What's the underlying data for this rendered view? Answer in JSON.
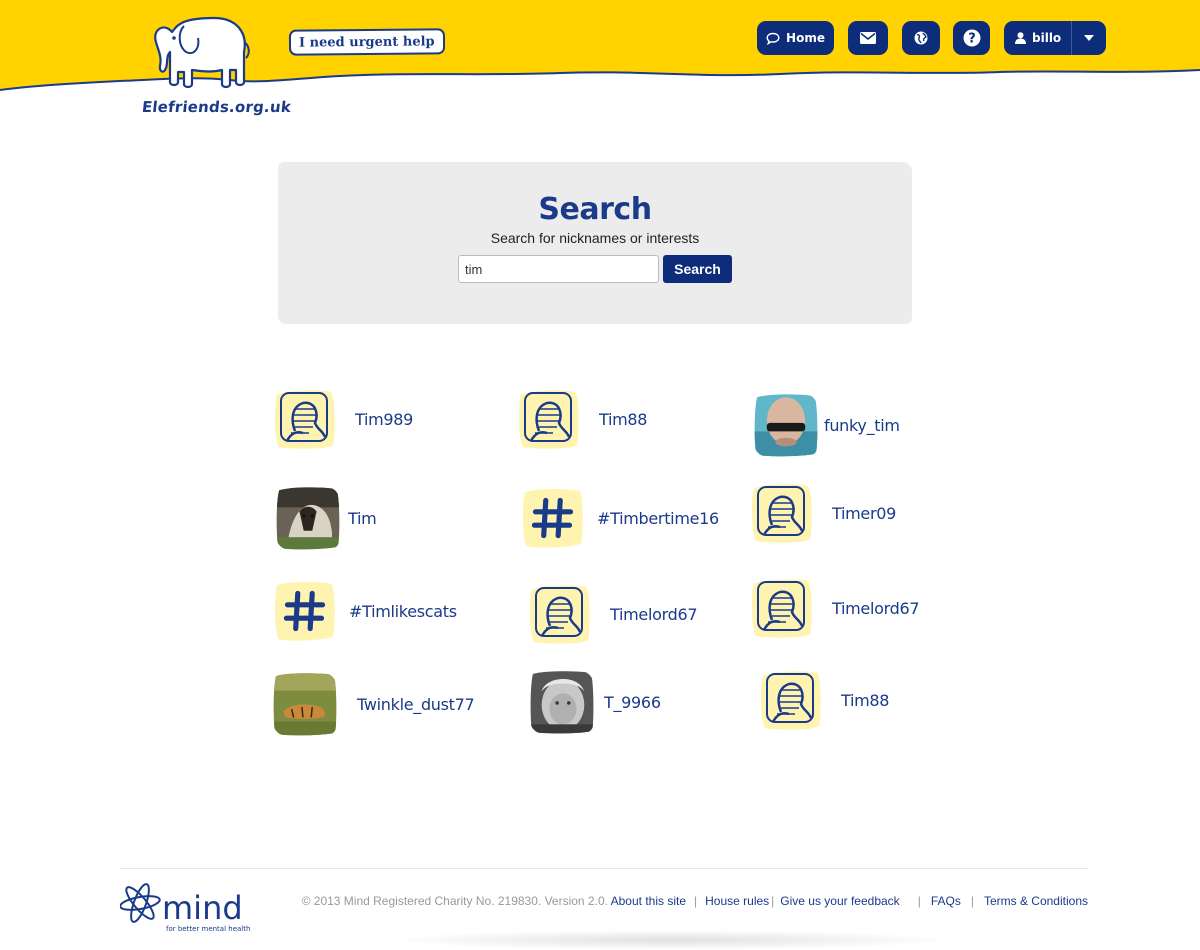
{
  "header": {
    "site_name": "Elefriends.org.uk",
    "urgent_help_label": "I need urgent help",
    "nav": {
      "home_label": "Home",
      "user_label": "billo"
    },
    "icons": {
      "home": "speech-bubble-icon",
      "mail": "envelope-icon",
      "globe": "globe-icon",
      "help": "question-icon",
      "user": "user-icon",
      "menu": "caret-down-icon"
    },
    "colors": {
      "band": "#ffd200",
      "nav": "#0d2d7a",
      "brand_blue": "#1a3a8a"
    }
  },
  "search": {
    "title": "Search",
    "subtitle": "Search for nicknames or interests",
    "query": "tim",
    "button_label": "Search"
  },
  "results": [
    {
      "name": "Tim989",
      "avatar": "default-avatar"
    },
    {
      "name": "Tim88",
      "avatar": "default-avatar"
    },
    {
      "name": "funky_tim",
      "avatar": "photo"
    },
    {
      "name": "Tim",
      "avatar": "photo"
    },
    {
      "name": "#Timbertime16",
      "avatar": "hashtag"
    },
    {
      "name": "Timer09",
      "avatar": "default-avatar"
    },
    {
      "name": "#Timlikescats",
      "avatar": "hashtag"
    },
    {
      "name": "Timelord67",
      "avatar": "default-avatar"
    },
    {
      "name": "Timelord67",
      "avatar": "default-avatar"
    },
    {
      "name": "Twinkle_dust77",
      "avatar": "photo"
    },
    {
      "name": "T_9966",
      "avatar": "photo"
    },
    {
      "name": "Tim88",
      "avatar": "default-avatar"
    }
  ],
  "footer": {
    "logo_text": "mind",
    "logo_tagline": "for better mental health",
    "copyright": "© 2013 Mind Registered Charity No. 219830. Version 2.0.",
    "links": [
      "About this site",
      "House rules",
      "Give us your feedback",
      "FAQs",
      "Terms & Conditions"
    ]
  }
}
